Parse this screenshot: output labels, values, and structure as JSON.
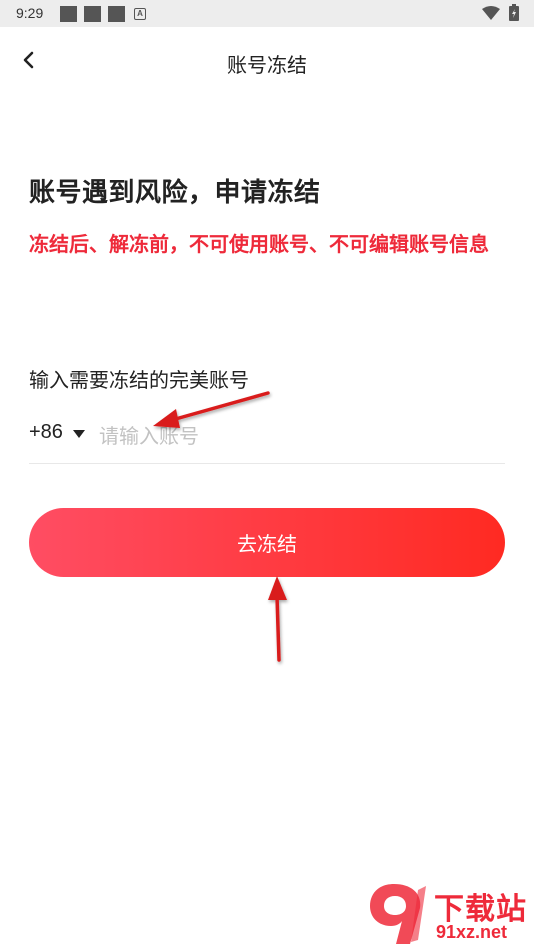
{
  "status_bar": {
    "time": "9:29",
    "notification_icons": [
      "square-icon",
      "square-icon",
      "square-icon",
      "a-icon"
    ],
    "a_icon_text": "A",
    "right_icons": [
      "wifi-icon",
      "battery-icon"
    ]
  },
  "header": {
    "back_icon": "chevron-left-icon",
    "title": "账号冻结"
  },
  "main": {
    "heading": "账号遇到风险，申请冻结",
    "warning": "冻结后、解冻前，不可使用账号、不可编辑账号信息",
    "input_label": "输入需要冻结的完美账号",
    "country_code": "+86",
    "country_caret_icon": "caret-down-icon",
    "phone_placeholder": "请输入账号",
    "phone_value": "",
    "submit_label": "去冻结"
  },
  "watermark": {
    "title": "下载站",
    "subtitle": "91xz.net"
  },
  "colors": {
    "accent_red": "#ee2a3a",
    "button_gradient_start": "#ff4d63",
    "button_gradient_end": "#ff2a22",
    "annotation_arrow": "#d91c1c"
  }
}
